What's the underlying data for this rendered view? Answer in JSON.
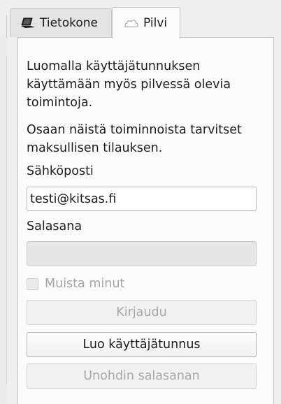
{
  "tabs": [
    {
      "label": "Tietokone",
      "icon": "laptop-icon",
      "active": false
    },
    {
      "label": "Pilvi",
      "icon": "cloud-icon",
      "active": true
    }
  ],
  "intro": {
    "paragraph1": "Luomalla käyttäjätunnuksen\nkäyttämään myös pilvessä olevia\ntoimintoja.",
    "paragraph2": "Osaan näistä toiminnoista tarvitset\nmaksullisen tilauksen."
  },
  "form": {
    "email_label": "Sähköposti",
    "email_value": "testi@kitsas.fi",
    "password_label": "Salasana",
    "password_value": "",
    "remember_label": "Muista minut",
    "remember_checked": false
  },
  "buttons": {
    "login": "Kirjaudu",
    "create_account": "Luo käyttäjätunnus",
    "forgot_password": "Unohdin salasanan"
  },
  "colors": {
    "panel_bg": "#fbfbfb",
    "window_bg": "#efefef",
    "disabled_text": "#a8a8a8"
  }
}
